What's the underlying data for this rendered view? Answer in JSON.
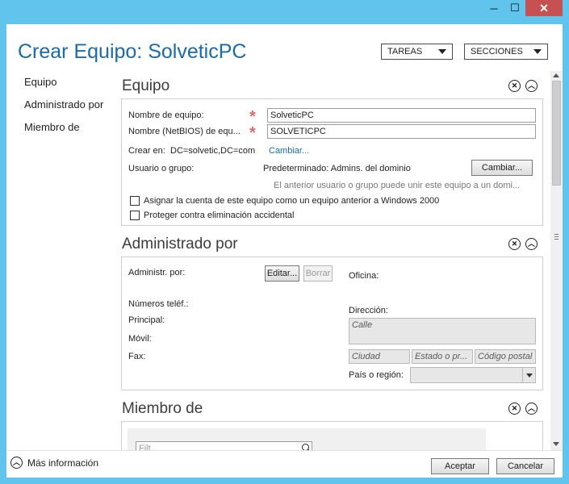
{
  "titlebar": {
    "minimize": "─",
    "maximize": "☐",
    "close": "✕"
  },
  "window_title": "Crear Equipo: SolveticPC",
  "header": {
    "tareas": "TAREAS",
    "secciones": "SECCIONES"
  },
  "nav": {
    "items": [
      {
        "label": "Equipo"
      },
      {
        "label": "Administrado por"
      },
      {
        "label": "Miembro de"
      }
    ]
  },
  "equipo": {
    "title": "Equipo",
    "name_label": "Nombre de equipo:",
    "name_value": "SolveticPC",
    "netbios_label": "Nombre (NetBIOS) de equ...",
    "netbios_value": "SOLVETICPC",
    "crear_en_label": "Crear en:",
    "crear_en_value": "DC=solvetic,DC=com",
    "cambiar_link": "Cambiar...",
    "usuario_label": "Usuario o grupo:",
    "usuario_value": "Predeterminado: Admins. del dominio",
    "cambiar_button": "Cambiar...",
    "note": "El anterior usuario o grupo puede unir este equipo a un domi...",
    "checkbox_1": "Asignar la cuenta de este equipo como un equipo anterior a Windows 2000",
    "checkbox_2": "Proteger contra eliminación accidental"
  },
  "administrado": {
    "title": "Administrado por",
    "admin_label": "Administr. por:",
    "editar": "Editar...",
    "borrar": "Borrar",
    "oficina": "Oficina:",
    "numeros": "Números teléf.:",
    "principal": "Principal:",
    "movil": "Móvil:",
    "fax": "Fax:",
    "direccion": "Dirección:",
    "calle": "Calle",
    "ciudad": "Ciudad",
    "estado": "Estado o pr...",
    "codigo": "Código postal",
    "pais": "País o región:"
  },
  "miembro": {
    "title": "Miembro de",
    "filter_placeholder": "Filt..."
  },
  "footer": {
    "more_info": "Más información",
    "aceptar": "Aceptar",
    "cancelar": "Cancelar"
  }
}
